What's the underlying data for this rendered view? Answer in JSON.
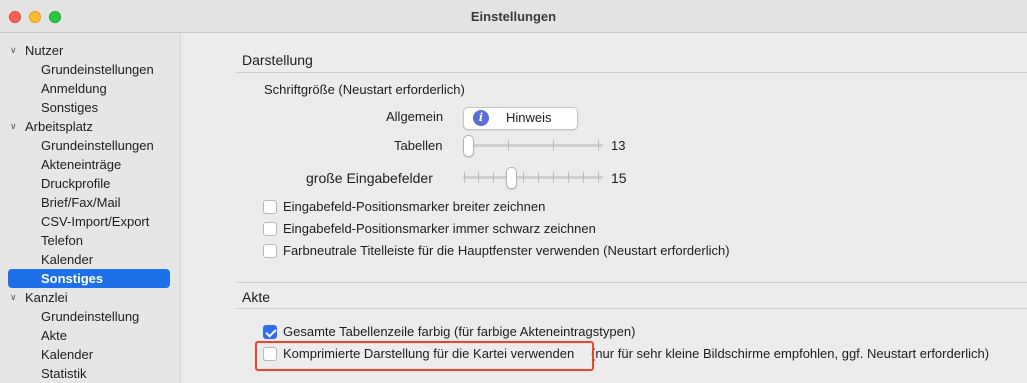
{
  "window": {
    "title": "Einstellungen"
  },
  "sidebar": {
    "groups": [
      {
        "label": "Nutzer",
        "items": [
          {
            "label": "Grundeinstellungen"
          },
          {
            "label": "Anmeldung"
          },
          {
            "label": "Sonstiges"
          }
        ]
      },
      {
        "label": "Arbeitsplatz",
        "items": [
          {
            "label": "Grundeinstellungen"
          },
          {
            "label": "Akteneinträge"
          },
          {
            "label": "Druckprofile"
          },
          {
            "label": "Brief/Fax/Mail"
          },
          {
            "label": "CSV-Import/Export"
          },
          {
            "label": "Telefon"
          },
          {
            "label": "Kalender"
          },
          {
            "label": "Sonstiges",
            "selected": true
          }
        ]
      },
      {
        "label": "Kanzlei",
        "items": [
          {
            "label": "Grundeinstellung"
          },
          {
            "label": "Akte"
          },
          {
            "label": "Kalender"
          },
          {
            "label": "Statistik"
          }
        ]
      }
    ],
    "selection_color": "#1f6feb"
  },
  "darstellung": {
    "title": "Darstellung",
    "font_size_heading": "Schriftgröße (Neustart erforderlich)",
    "allgemein_label": "Allgemein",
    "hinweis_button": "Hinweis",
    "info_icon": "info-icon",
    "tabellen_label": "Tabellen",
    "tabellen_value": "13",
    "tabellen_level": 0,
    "eingabefelder_label": "große Eingabefelder",
    "eingabefelder_value": "15",
    "eingabefelder_level": 0.33,
    "checkboxes": [
      {
        "label": "Eingabefeld-Positionsmarker breiter zeichnen",
        "checked": false
      },
      {
        "label": "Eingabefeld-Positionsmarker immer schwarz zeichnen",
        "checked": false
      },
      {
        "label": "Farbneutrale Titelleiste für die Hauptfenster verwenden (Neustart erforderlich)",
        "checked": false
      }
    ]
  },
  "akte": {
    "title": "Akte",
    "checkboxes": [
      {
        "label": "Gesamte Tabellenzeile farbig (für farbige Akteneintragstypen)",
        "checked": true
      },
      {
        "label": "Komprimierte Darstellung für die Kartei verwenden",
        "checked": false
      }
    ],
    "note": "(nur für sehr kleine Bildschirme empfohlen, ggf. Neustart erforderlich)"
  },
  "colors": {
    "accent": "#2f6df0",
    "highlight": "#f0432c"
  }
}
